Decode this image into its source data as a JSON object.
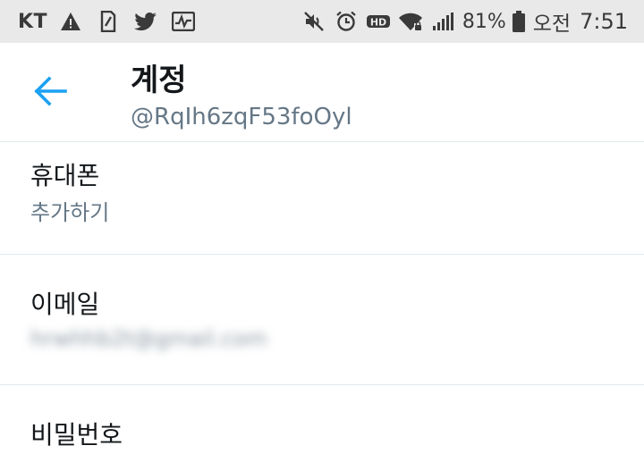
{
  "status_bar": {
    "carrier": "KT",
    "battery": "81%",
    "ampm": "오전",
    "time": "7:51",
    "icons": [
      "warning-icon",
      "sim-icon",
      "twitter-icon",
      "activity-icon",
      "mute-icon",
      "alarm-icon",
      "hd-icon",
      "wifi-icon",
      "signal-icon",
      "battery-icon"
    ]
  },
  "header": {
    "title": "계정",
    "subtitle": "@RqIh6zqF53foOyl"
  },
  "rows": [
    {
      "title": "휴대폰",
      "value": "추가하기"
    },
    {
      "title": "이메일",
      "value": "hrwhhb2t@gmail.com"
    },
    {
      "title": "비밀번호"
    }
  ],
  "colors": {
    "accent": "#1da1f2",
    "text_primary": "#14171a",
    "text_secondary": "#657786",
    "divider": "#e1e8ed",
    "status_bar_bg": "#e9e9e9"
  }
}
